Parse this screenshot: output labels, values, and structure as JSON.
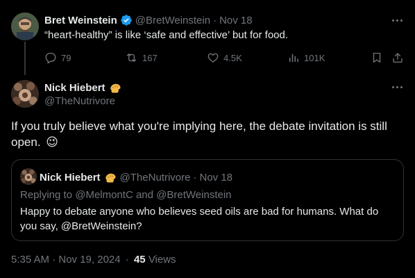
{
  "parent_tweet": {
    "author_name": "Bret Weinstein",
    "handle": "@BretWeinstein",
    "date": "Nov 18",
    "text": "“heart-healthy” is like ‘safe and effective’ but for food.",
    "actions": {
      "replies": "79",
      "retweets": "167",
      "likes": "4.5K",
      "views": "101K"
    }
  },
  "main_tweet": {
    "author_name": "Nick Hiebert",
    "handle": "@TheNutrivore",
    "text": "If you truly believe what you're implying here, the debate invitation is still open.",
    "emoji": "😉",
    "timestamp": "5:35 AM · Nov 19, 2024",
    "views_count": "45",
    "views_label": "Views"
  },
  "quoted_tweet": {
    "author_name": "Nick Hiebert",
    "handle": "@TheNutrivore",
    "date": "Nov 18",
    "reply_prefix": "Replying to",
    "reply_to_1": "@MelmontC",
    "reply_and": "and",
    "reply_to_2": "@BretWeinstein",
    "text_main": "Happy to debate anyone who believes seed oils are bad for humans. What do you say, ",
    "text_mention": "@BretWeinstein",
    "text_end": "?"
  },
  "colors": {
    "background": "#000000",
    "text": "#e7e9ea",
    "muted": "#71767b",
    "verified_blue": "#1d9bf0",
    "border": "#2f3336"
  }
}
